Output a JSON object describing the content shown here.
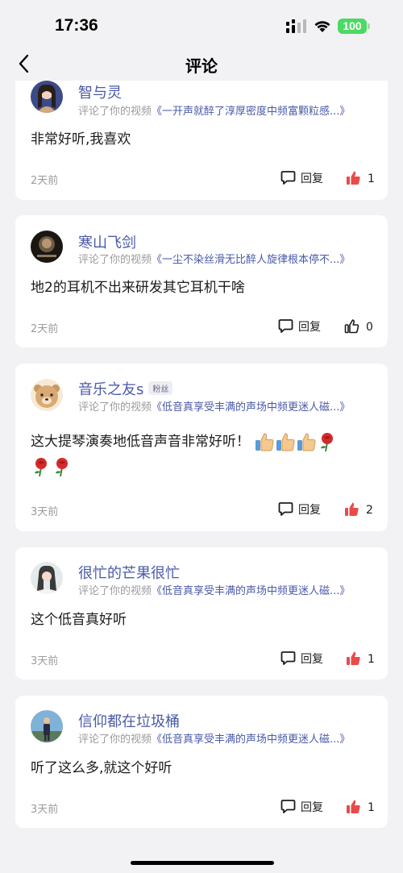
{
  "status_bar": {
    "time": "17:36",
    "battery": "100"
  },
  "header": {
    "title": "评论"
  },
  "colors": {
    "accent": "#4a5aa8",
    "like_active": "#e94b4b",
    "battery": "#4cd964"
  },
  "comments": [
    {
      "user": "智与灵",
      "activity_prefix": "评论了你的视频",
      "video_title": "《一开声就醉了淳厚密度中频富颗粒感...》",
      "text": "非常好听,我喜欢",
      "time": "2天前",
      "reply_label": "回复",
      "likes": "1",
      "liked": true
    },
    {
      "user": "寒山飞剑",
      "activity_prefix": "评论了你的视频",
      "video_title": "《一尘不染丝滑无比醉人旋律根本停不...》",
      "text": "地2的耳机不出来研发其它耳机干啥",
      "time": "2天前",
      "reply_label": "回复",
      "likes": "0",
      "liked": false
    },
    {
      "user": "音乐之友s",
      "badge": "粉丝",
      "activity_prefix": "评论了你的视频",
      "video_title": "《低音真享受丰满的声场中频更迷人磁...》",
      "text": "这大提琴演奏地低音声音非常好听！",
      "emojis": [
        "thumbs-up-emoji",
        "thumbs-up-emoji",
        "thumbs-up-emoji",
        "rose-emoji",
        "rose-emoji",
        "rose-emoji"
      ],
      "time": "3天前",
      "reply_label": "回复",
      "likes": "2",
      "liked": true
    },
    {
      "user": "很忙的芒果很忙",
      "activity_prefix": "评论了你的视频",
      "video_title": "《低音真享受丰满的声场中频更迷人磁...》",
      "text": "这个低音真好听",
      "time": "3天前",
      "reply_label": "回复",
      "likes": "1",
      "liked": true
    },
    {
      "user": "信仰都在垃圾桶",
      "activity_prefix": "评论了你的视频",
      "video_title": "《低音真享受丰满的声场中频更迷人磁...》",
      "text": "听了这么多,就这个好听",
      "time": "3天前",
      "reply_label": "回复",
      "likes": "1",
      "liked": true
    }
  ]
}
